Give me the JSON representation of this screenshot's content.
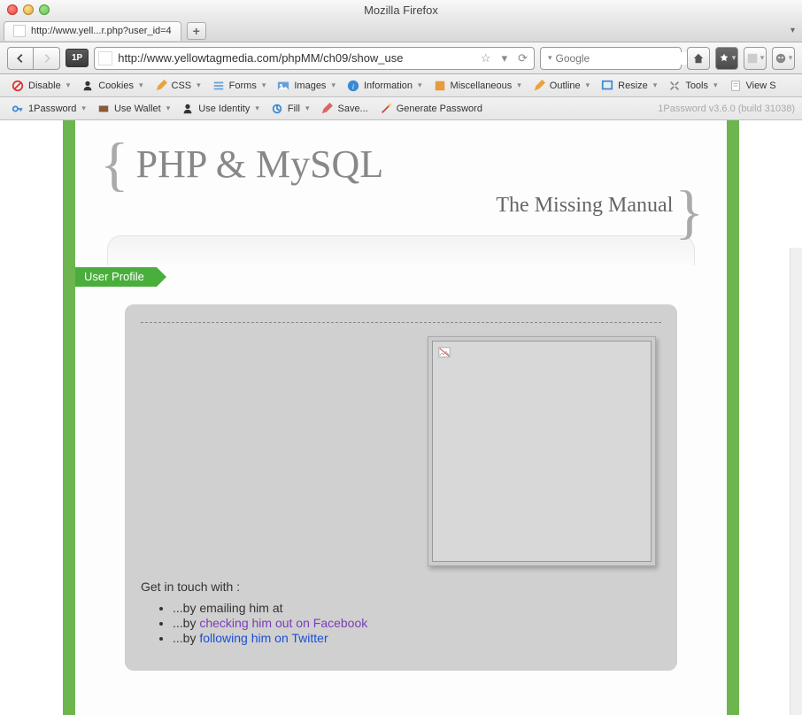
{
  "window": {
    "title": "Mozilla Firefox"
  },
  "tab": {
    "label": "http://www.yell...r.php?user_id=4"
  },
  "nav": {
    "onep": "1P",
    "url": "http://www.yellowtagmedia.com/phpMM/ch09/show_use",
    "search_placeholder": "Google"
  },
  "dev": {
    "disable": "Disable",
    "cookies": "Cookies",
    "css": "CSS",
    "forms": "Forms",
    "images": "Images",
    "information": "Information",
    "misc": "Miscellaneous",
    "outline": "Outline",
    "resize": "Resize",
    "tools": "Tools",
    "view": "View S"
  },
  "pw": {
    "onepassword": "1Password",
    "usewallet": "Use Wallet",
    "useidentity": "Use Identity",
    "fill": "Fill",
    "save": "Save...",
    "generate": "Generate Password",
    "version": "1Password v3.6.0 (build 31038)"
  },
  "page": {
    "title": "PHP & MySQL",
    "subtitle": "The Missing Manual",
    "ribbon": "User Profile",
    "contact_intro": "Get in touch with :",
    "contact1_prefix": "...by emailing him at",
    "contact2_prefix": "...by ",
    "contact2_link": "checking him out on Facebook",
    "contact3_prefix": "...by ",
    "contact3_link": "following him on Twitter"
  }
}
